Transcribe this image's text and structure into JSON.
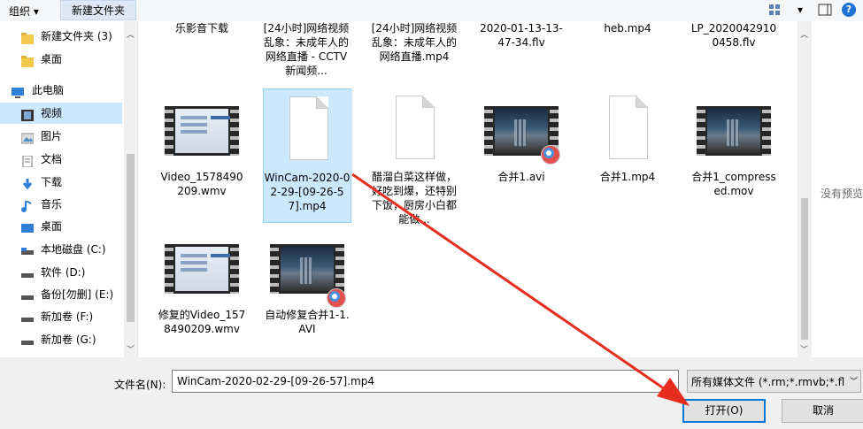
{
  "toolbar": {
    "organize": "组织 ▾",
    "new_folder": "新建文件夹",
    "help": "?"
  },
  "nav": {
    "items": [
      {
        "label": "新建文件夹 (3)",
        "icon": "folder-icon"
      },
      {
        "label": "桌面",
        "icon": "folder-icon"
      },
      {
        "label": "此电脑",
        "icon": "pc-icon"
      },
      {
        "label": "视频",
        "icon": "video-folder-icon"
      },
      {
        "label": "图片",
        "icon": "picture-folder-icon"
      },
      {
        "label": "文档",
        "icon": "document-folder-icon"
      },
      {
        "label": "下载",
        "icon": "download-icon"
      },
      {
        "label": "音乐",
        "icon": "music-icon"
      },
      {
        "label": "桌面",
        "icon": "desktop-icon"
      },
      {
        "label": "本地磁盘 (C:)",
        "icon": "drive-icon"
      },
      {
        "label": "软件 (D:)",
        "icon": "drive-icon"
      },
      {
        "label": "备份[勿删] (E:)",
        "icon": "drive-icon"
      },
      {
        "label": "新加卷 (F:)",
        "icon": "drive-icon"
      },
      {
        "label": "新加卷 (G:)",
        "icon": "drive-icon"
      }
    ]
  },
  "files": {
    "top_row": [
      {
        "label": "乐影音下载"
      },
      {
        "label": "[24小时]网络视频乱象：未成年人的网络直播 - CCTV 新闻频..."
      },
      {
        "label": "[24小时]网络视频乱象：未成年人的网络直播.mp4"
      },
      {
        "label": "2020-01-13-13-47-34.flv"
      },
      {
        "label": "heb.mp4"
      },
      {
        "label": "LP_2020042910 0458.flv"
      }
    ],
    "row2": [
      {
        "label": "Video_1578490209.wmv"
      },
      {
        "label": "WinCam-2020-02-29-[09-26-57].mp4"
      },
      {
        "label": "醋溜白菜这样做，好吃到爆，还特别下饭，厨房小白都能做..."
      },
      {
        "label": "合并1.avi"
      },
      {
        "label": "合并1.mp4"
      },
      {
        "label": "合并1_compressed.mov"
      }
    ],
    "row3": [
      {
        "label": "修复的Video_1578490209.wmv"
      },
      {
        "label": "自动修复合并1-1.AVI"
      }
    ]
  },
  "preview": {
    "text": "没有预览"
  },
  "bottom": {
    "filename_label": "文件名(N):",
    "filename_value": "WinCam-2020-02-29-[09-26-57].mp4",
    "filter_value": "所有媒体文件 (*.rm;*.rmvb;*.fl",
    "open_label": "打开(O)",
    "cancel_label": "取消"
  },
  "colors": {
    "accent": "#0078d7",
    "selection": "#cce8ff",
    "arrow": "#e62d1e"
  }
}
